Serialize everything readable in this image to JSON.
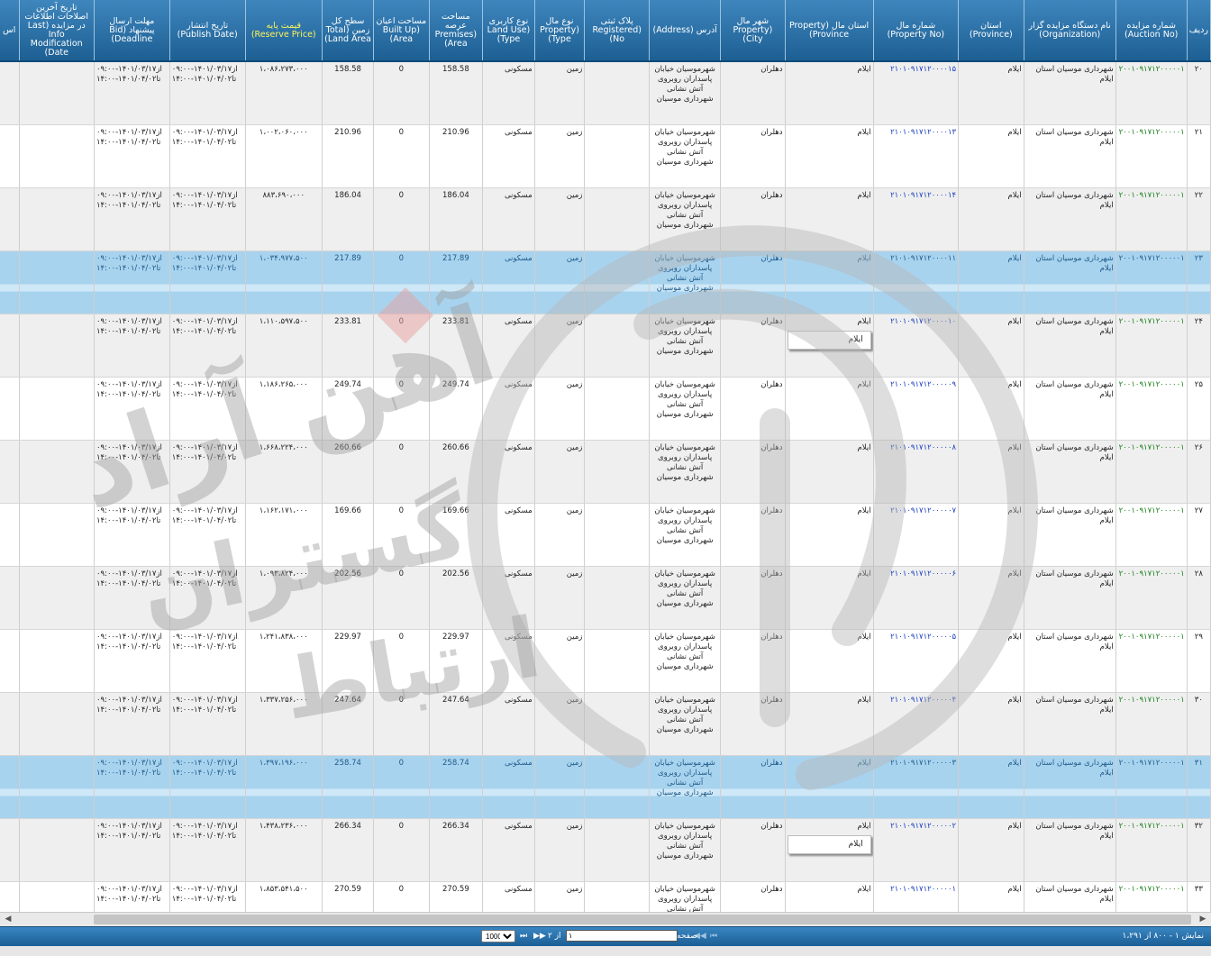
{
  "headers": {
    "row_no": "ردیف",
    "auction_no": "شماره مزایده (Auction No)",
    "organization": "نام دستگاه مزایده گزار (Organization)",
    "province": "استان (Province)",
    "property_no": "شماره مال (Property No)",
    "property_province": "استان مال (Property Province)",
    "property_city": "شهر مال (Property City)",
    "address": "آدرس (Address)",
    "registered_no": "پلاک ثبتی (Registered No)",
    "property_type": "نوع مال (Property Type)",
    "land_use": "نوع کاربری (Land Use Type)",
    "premises_area": "مساحت عرصه (Premises Area)",
    "built_up_area": "مساحت اعیان (Built Up Area)",
    "total_land_area": "سطح کل زمین (Total Land Area)",
    "reserve_price": "قیمت پایه (Reserve Price)",
    "publish_date": "تاریخ انتشار (Publish Date)",
    "deadline": "مهلت ارسال پیشنهاد (Bid Deadline)",
    "last_modification": "تاریخ آخرین اصلاحات اطلاعات در مزایده (Last Info Modification Date)",
    "extra": "اس"
  },
  "rows": [
    {
      "row_no": "۲۰",
      "auction_no": "۲۰۰۱۰۹۱۷۱۲۰۰۰۰۰۱",
      "organization": "شهرداری موسیان استان ایلام",
      "province": "ایلام",
      "property_no": "۲۱۰۱۰۹۱۷۱۲۰۰۰۰۱۵",
      "property_province": "ایلام",
      "property_city": "دهلران",
      "address": "شهرموسیان خیابان پاسداران روبروی آتش نشانی شهرداری موسیان",
      "registered_no": "",
      "property_type": "زمین",
      "land_use": "مسکونی",
      "premises_area": "158.58",
      "built_up_area": "0",
      "total_land_area": "158.58",
      "reserve_price": "۱،۰۸۶،۲۷۳،۰۰۰",
      "publish_date": "از۱۴۰۱/۰۳/۱۷-۰۹:۰۰ تا۱۴۰۱/۰۴/۰۲-۱۴:۰۰",
      "deadline": "از۱۴۰۱/۰۳/۱۷-۰۹:۰۰ تا۱۴۰۱/۰۴/۰۲-۱۴:۰۰",
      "last_modification": "",
      "selected": false,
      "tooltip": ""
    },
    {
      "row_no": "۲۱",
      "auction_no": "۲۰۰۱۰۹۱۷۱۲۰۰۰۰۰۱",
      "organization": "شهرداری موسیان استان ایلام",
      "province": "ایلام",
      "property_no": "۲۱۰۱۰۹۱۷۱۲۰۰۰۰۱۳",
      "property_province": "ایلام",
      "property_city": "دهلران",
      "address": "شهرموسیان خیابان پاسداران روبروی آتش نشانی شهرداری موسیان",
      "registered_no": "",
      "property_type": "زمین",
      "land_use": "مسکونی",
      "premises_area": "210.96",
      "built_up_area": "0",
      "total_land_area": "210.96",
      "reserve_price": "۱،۰۰۲،۰۶۰،۰۰۰",
      "publish_date": "از۱۴۰۱/۰۳/۱۷-۰۹:۰۰ تا۱۴۰۱/۰۴/۰۲-۱۴:۰۰",
      "deadline": "از۱۴۰۱/۰۳/۱۷-۰۹:۰۰ تا۱۴۰۱/۰۴/۰۲-۱۴:۰۰",
      "last_modification": "",
      "selected": false,
      "tooltip": ""
    },
    {
      "row_no": "۲۲",
      "auction_no": "۲۰۰۱۰۹۱۷۱۲۰۰۰۰۰۱",
      "organization": "شهرداری موسیان استان ایلام",
      "province": "ایلام",
      "property_no": "۲۱۰۱۰۹۱۷۱۲۰۰۰۰۱۴",
      "property_province": "ایلام",
      "property_city": "دهلران",
      "address": "شهرموسیان خیابان پاسداران روبروی آتش نشانی شهرداری موسیان",
      "registered_no": "",
      "property_type": "زمین",
      "land_use": "مسکونی",
      "premises_area": "186.04",
      "built_up_area": "0",
      "total_land_area": "186.04",
      "reserve_price": "۸۸۳،۶۹۰،۰۰۰",
      "publish_date": "از۱۴۰۱/۰۳/۱۷-۰۹:۰۰ تا۱۴۰۱/۰۴/۰۲-۱۴:۰۰",
      "deadline": "از۱۴۰۱/۰۳/۱۷-۰۹:۰۰ تا۱۴۰۱/۰۴/۰۲-۱۴:۰۰",
      "last_modification": "",
      "selected": false,
      "tooltip": ""
    },
    {
      "row_no": "۲۳",
      "auction_no": "۲۰۰۱۰۹۱۷۱۲۰۰۰۰۰۱",
      "organization": "شهرداری موسیان استان ایلام",
      "province": "ایلام",
      "property_no": "۲۱۰۱۰۹۱۷۱۲۰۰۰۰۱۱",
      "property_province": "ایلام",
      "property_city": "دهلران",
      "address": "شهرموسیان خیابان پاسداران روبروی آتش نشانی شهرداری موسیان",
      "registered_no": "",
      "property_type": "زمین",
      "land_use": "مسکونی",
      "premises_area": "217.89",
      "built_up_area": "0",
      "total_land_area": "217.89",
      "reserve_price": "۱،۰۳۴،۹۷۷،۵۰۰",
      "publish_date": "از۱۴۰۱/۰۳/۱۷-۰۹:۰۰ تا۱۴۰۱/۰۴/۰۲-۱۴:۰۰",
      "deadline": "از۱۴۰۱/۰۳/۱۷-۰۹:۰۰ تا۱۴۰۱/۰۴/۰۲-۱۴:۰۰",
      "last_modification": "",
      "selected": true,
      "tooltip": ""
    },
    {
      "row_no": "۲۴",
      "auction_no": "۲۰۰۱۰۹۱۷۱۲۰۰۰۰۰۱",
      "organization": "شهرداری موسیان استان ایلام",
      "province": "ایلام",
      "property_no": "۲۱۰۱۰۹۱۷۱۲۰۰۰۰۱۰",
      "property_province": "ایلام",
      "property_city": "دهلران",
      "address": "شهرموسیان خیابان پاسداران روبروی آتش نشانی شهرداری موسیان",
      "registered_no": "",
      "property_type": "زمین",
      "land_use": "مسکونی",
      "premises_area": "233.81",
      "built_up_area": "0",
      "total_land_area": "233.81",
      "reserve_price": "۱،۱۱۰،۵۹۷،۵۰۰",
      "publish_date": "از۱۴۰۱/۰۳/۱۷-۰۹:۰۰ تا۱۴۰۱/۰۴/۰۲-۱۴:۰۰",
      "deadline": "از۱۴۰۱/۰۳/۱۷-۰۹:۰۰ تا۱۴۰۱/۰۴/۰۲-۱۴:۰۰",
      "last_modification": "",
      "selected": false,
      "tooltip": "ایلام"
    },
    {
      "row_no": "۲۵",
      "auction_no": "۲۰۰۱۰۹۱۷۱۲۰۰۰۰۰۱",
      "organization": "شهرداری موسیان استان ایلام",
      "province": "ایلام",
      "property_no": "۲۱۰۱۰۹۱۷۱۲۰۰۰۰۰۹",
      "property_province": "ایلام",
      "property_city": "دهلران",
      "address": "شهرموسیان خیابان پاسداران روبروی آتش نشانی شهرداری موسیان",
      "registered_no": "",
      "property_type": "زمین",
      "land_use": "مسکونی",
      "premises_area": "249.74",
      "built_up_area": "0",
      "total_land_area": "249.74",
      "reserve_price": "۱،۱۸۶،۲۶۵،۰۰۰",
      "publish_date": "از۱۴۰۱/۰۳/۱۷-۰۹:۰۰ تا۱۴۰۱/۰۴/۰۲-۱۴:۰۰",
      "deadline": "از۱۴۰۱/۰۳/۱۷-۰۹:۰۰ تا۱۴۰۱/۰۴/۰۲-۱۴:۰۰",
      "last_modification": "",
      "selected": false,
      "tooltip": ""
    },
    {
      "row_no": "۲۶",
      "auction_no": "۲۰۰۱۰۹۱۷۱۲۰۰۰۰۰۱",
      "organization": "شهرداری موسیان استان ایلام",
      "province": "ایلام",
      "property_no": "۲۱۰۱۰۹۱۷۱۲۰۰۰۰۰۸",
      "property_province": "ایلام",
      "property_city": "دهلران",
      "address": "شهرموسیان خیابان پاسداران روبروی آتش نشانی شهرداری موسیان",
      "registered_no": "",
      "property_type": "زمین",
      "land_use": "مسکونی",
      "premises_area": "260.66",
      "built_up_area": "0",
      "total_land_area": "260.66",
      "reserve_price": "۱،۶۶۸،۲۲۴،۰۰۰",
      "publish_date": "از۱۴۰۱/۰۳/۱۷-۰۹:۰۰ تا۱۴۰۱/۰۴/۰۲-۱۴:۰۰",
      "deadline": "از۱۴۰۱/۰۳/۱۷-۰۹:۰۰ تا۱۴۰۱/۰۴/۰۲-۱۴:۰۰",
      "last_modification": "",
      "selected": false,
      "tooltip": ""
    },
    {
      "row_no": "۲۷",
      "auction_no": "۲۰۰۱۰۹۱۷۱۲۰۰۰۰۰۱",
      "organization": "شهرداری موسیان استان ایلام",
      "province": "ایلام",
      "property_no": "۲۱۰۱۰۹۱۷۱۲۰۰۰۰۰۷",
      "property_province": "ایلام",
      "property_city": "دهلران",
      "address": "شهرموسیان خیابان پاسداران روبروی آتش نشانی شهرداری موسیان",
      "registered_no": "",
      "property_type": "زمین",
      "land_use": "مسکونی",
      "premises_area": "169.66",
      "built_up_area": "0",
      "total_land_area": "169.66",
      "reserve_price": "۱،۱۶۲،۱۷۱،۰۰۰",
      "publish_date": "از۱۴۰۱/۰۳/۱۷-۰۹:۰۰ تا۱۴۰۱/۰۴/۰۲-۱۴:۰۰",
      "deadline": "از۱۴۰۱/۰۳/۱۷-۰۹:۰۰ تا۱۴۰۱/۰۴/۰۲-۱۴:۰۰",
      "last_modification": "",
      "selected": false,
      "tooltip": ""
    },
    {
      "row_no": "۲۸",
      "auction_no": "۲۰۰۱۰۹۱۷۱۲۰۰۰۰۰۱",
      "organization": "شهرداری موسیان استان ایلام",
      "province": "ایلام",
      "property_no": "۲۱۰۱۰۹۱۷۱۲۰۰۰۰۰۶",
      "property_province": "ایلام",
      "property_city": "دهلران",
      "address": "شهرموسیان خیابان پاسداران روبروی آتش نشانی شهرداری موسیان",
      "registered_no": "",
      "property_type": "زمین",
      "land_use": "مسکونی",
      "premises_area": "202.56",
      "built_up_area": "0",
      "total_land_area": "202.56",
      "reserve_price": "۱،۰۹۳،۸۲۴،۰۰۰",
      "publish_date": "از۱۴۰۱/۰۳/۱۷-۰۹:۰۰ تا۱۴۰۱/۰۴/۰۲-۱۴:۰۰",
      "deadline": "از۱۴۰۱/۰۳/۱۷-۰۹:۰۰ تا۱۴۰۱/۰۴/۰۲-۱۴:۰۰",
      "last_modification": "",
      "selected": false,
      "tooltip": ""
    },
    {
      "row_no": "۲۹",
      "auction_no": "۲۰۰۱۰۹۱۷۱۲۰۰۰۰۰۱",
      "organization": "شهرداری موسیان استان ایلام",
      "province": "ایلام",
      "property_no": "۲۱۰۱۰۹۱۷۱۲۰۰۰۰۰۵",
      "property_province": "ایلام",
      "property_city": "دهلران",
      "address": "شهرموسیان خیابان پاسداران روبروی آتش نشانی شهرداری موسیان",
      "registered_no": "",
      "property_type": "زمین",
      "land_use": "مسکونی",
      "premises_area": "229.97",
      "built_up_area": "0",
      "total_land_area": "229.97",
      "reserve_price": "۱،۲۴۱،۸۳۸،۰۰۰",
      "publish_date": "از۱۴۰۱/۰۳/۱۷-۰۹:۰۰ تا۱۴۰۱/۰۴/۰۲-۱۴:۰۰",
      "deadline": "از۱۴۰۱/۰۳/۱۷-۰۹:۰۰ تا۱۴۰۱/۰۴/۰۲-۱۴:۰۰",
      "last_modification": "",
      "selected": false,
      "tooltip": ""
    },
    {
      "row_no": "۳۰",
      "auction_no": "۲۰۰۱۰۹۱۷۱۲۰۰۰۰۰۱",
      "organization": "شهرداری موسیان استان ایلام",
      "province": "ایلام",
      "property_no": "۲۱۰۱۰۹۱۷۱۲۰۰۰۰۰۴",
      "property_province": "ایلام",
      "property_city": "دهلران",
      "address": "شهرموسیان خیابان پاسداران روبروی آتش نشانی شهرداری موسیان",
      "registered_no": "",
      "property_type": "زمین",
      "land_use": "مسکونی",
      "premises_area": "247.64",
      "built_up_area": "0",
      "total_land_area": "247.64",
      "reserve_price": "۱،۳۳۷،۲۵۶،۰۰۰",
      "publish_date": "از۱۴۰۱/۰۳/۱۷-۰۹:۰۰ تا۱۴۰۱/۰۴/۰۲-۱۴:۰۰",
      "deadline": "از۱۴۰۱/۰۳/۱۷-۰۹:۰۰ تا۱۴۰۱/۰۴/۰۲-۱۴:۰۰",
      "last_modification": "",
      "selected": false,
      "tooltip": ""
    },
    {
      "row_no": "۳۱",
      "auction_no": "۲۰۰۱۰۹۱۷۱۲۰۰۰۰۰۱",
      "organization": "شهرداری موسیان استان ایلام",
      "province": "ایلام",
      "property_no": "۲۱۰۱۰۹۱۷۱۲۰۰۰۰۰۳",
      "property_province": "ایلام",
      "property_city": "دهلران",
      "address": "شهرموسیان خیابان پاسداران روبروی آتش نشانی شهرداری موسیان",
      "registered_no": "",
      "property_type": "زمین",
      "land_use": "مسکونی",
      "premises_area": "258.74",
      "built_up_area": "0",
      "total_land_area": "258.74",
      "reserve_price": "۱،۳۹۷،۱۹۶،۰۰۰",
      "publish_date": "از۱۴۰۱/۰۳/۱۷-۰۹:۰۰ تا۱۴۰۱/۰۴/۰۲-۱۴:۰۰",
      "deadline": "از۱۴۰۱/۰۳/۱۷-۰۹:۰۰ تا۱۴۰۱/۰۴/۰۲-۱۴:۰۰",
      "last_modification": "",
      "selected": true,
      "tooltip": ""
    },
    {
      "row_no": "۳۲",
      "auction_no": "۲۰۰۱۰۹۱۷۱۲۰۰۰۰۰۱",
      "organization": "شهرداری موسیان استان ایلام",
      "province": "ایلام",
      "property_no": "۲۱۰۱۰۹۱۷۱۲۰۰۰۰۰۲",
      "property_province": "ایلام",
      "property_city": "دهلران",
      "address": "شهرموسیان خیابان پاسداران روبروی آتش نشانی شهرداری موسیان",
      "registered_no": "",
      "property_type": "زمین",
      "land_use": "مسکونی",
      "premises_area": "266.34",
      "built_up_area": "0",
      "total_land_area": "266.34",
      "reserve_price": "۱،۴۳۸،۲۳۶،۰۰۰",
      "publish_date": "از۱۴۰۱/۰۳/۱۷-۰۹:۰۰ تا۱۴۰۱/۰۴/۰۲-۱۴:۰۰",
      "deadline": "از۱۴۰۱/۰۳/۱۷-۰۹:۰۰ تا۱۴۰۱/۰۴/۰۲-۱۴:۰۰",
      "last_modification": "",
      "selected": false,
      "tooltip": "ایلام"
    },
    {
      "row_no": "۳۳",
      "auction_no": "۲۰۰۱۰۹۱۷۱۲۰۰۰۰۰۱",
      "organization": "شهرداری موسیان استان ایلام",
      "province": "ایلام",
      "property_no": "۲۱۰۱۰۹۱۷۱۲۰۰۰۰۰۱",
      "property_province": "ایلام",
      "property_city": "دهلران",
      "address": "شهرموسیان خیابان پاسداران روبروی آتش نشانی شهرداری موسیان",
      "registered_no": "",
      "property_type": "زمین",
      "land_use": "مسکونی",
      "premises_area": "270.59",
      "built_up_area": "0",
      "total_land_area": "270.59",
      "reserve_price": "۱،۸۵۳،۵۴۱،۵۰۰",
      "publish_date": "از۱۴۰۱/۰۳/۱۷-۰۹:۰۰ تا۱۴۰۱/۰۴/۰۲-۱۴:۰۰",
      "deadline": "از۱۴۰۱/۰۳/۱۷-۰۹:۰۰ تا۱۴۰۱/۰۴/۰۲-۱۴:۰۰",
      "last_modification": "",
      "selected": false,
      "tooltip": ""
    }
  ],
  "pager": {
    "status": "نمایش ۱ - ۸۰۰ از ۱،۲۹۱",
    "page_label": "صفحه",
    "page_value": "۱",
    "of_label": "از ۲",
    "page_size": "1000",
    "page_size_options": [
      "1000"
    ]
  },
  "watermark": {
    "brand_line1": "آهن آراد",
    "brand_line2": "گستران",
    "brand_line3": "ارتباط",
    "color": "#b5b5b5",
    "accent": "#e8a0a0"
  },
  "colors": {
    "header_top": "#3e86bd",
    "header_bottom": "#1d5f93",
    "selected_row": "#a8d3ee",
    "auction_no": "#1a7f1a",
    "property_no": "#1b3fbf"
  }
}
